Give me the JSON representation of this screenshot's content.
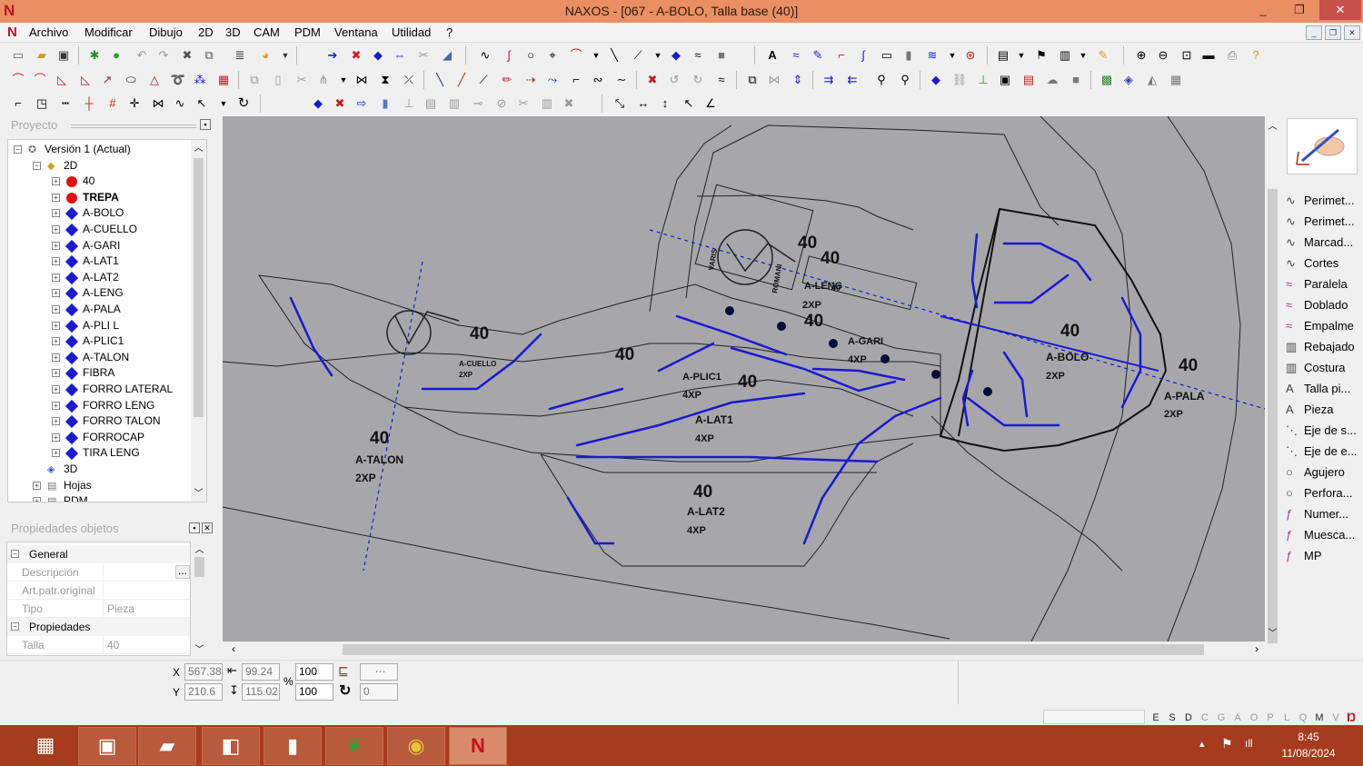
{
  "window": {
    "title": "NAXOS - [067 - A-BOLO, Talla base (40)]",
    "logo": "N",
    "controls": [
      "_",
      "❐",
      "✕"
    ],
    "mdi_controls": [
      "_",
      "❐",
      "✕"
    ]
  },
  "menu": [
    "Archivo",
    "Modificar",
    "Dibujo",
    "2D",
    "3D",
    "CAM",
    "PDM",
    "Ventana",
    "Utilidad",
    "?"
  ],
  "project_panel": {
    "header": "Proyecto",
    "tree": [
      {
        "label": "Versión 1 (Actual)",
        "level": 0,
        "icon": "version-icon",
        "expander": "−"
      },
      {
        "label": "2D",
        "level": 1,
        "icon": "2d-icon",
        "expander": "−"
      },
      {
        "label": "40",
        "level": 2,
        "icon": "red-dot",
        "expander": "+"
      },
      {
        "label": "TREPA",
        "level": 2,
        "icon": "red-dot",
        "expander": "+",
        "bold": true
      },
      {
        "label": "A-BOLO",
        "level": 2,
        "icon": "blue-diamond",
        "expander": "+"
      },
      {
        "label": "A-CUELLO",
        "level": 2,
        "icon": "blue-diamond",
        "expander": "+"
      },
      {
        "label": "A-GARI",
        "level": 2,
        "icon": "blue-diamond",
        "expander": "+"
      },
      {
        "label": "A-LAT1",
        "level": 2,
        "icon": "blue-diamond",
        "expander": "+"
      },
      {
        "label": "A-LAT2",
        "level": 2,
        "icon": "blue-diamond",
        "expander": "+"
      },
      {
        "label": "A-LENG",
        "level": 2,
        "icon": "blue-diamond",
        "expander": "+"
      },
      {
        "label": "A-PALA",
        "level": 2,
        "icon": "blue-diamond",
        "expander": "+"
      },
      {
        "label": "A-PLI L",
        "level": 2,
        "icon": "blue-diamond",
        "expander": "+"
      },
      {
        "label": "A-PLIC1",
        "level": 2,
        "icon": "blue-diamond",
        "expander": "+"
      },
      {
        "label": "A-TALON",
        "level": 2,
        "icon": "blue-diamond",
        "expander": "+"
      },
      {
        "label": "FIBRA",
        "level": 2,
        "icon": "blue-diamond",
        "expander": "+"
      },
      {
        "label": "FORRO LATERAL",
        "level": 2,
        "icon": "blue-diamond",
        "expander": "+"
      },
      {
        "label": "FORRO LENG",
        "level": 2,
        "icon": "blue-diamond",
        "expander": "+"
      },
      {
        "label": "FORRO TALON",
        "level": 2,
        "icon": "blue-diamond",
        "expander": "+"
      },
      {
        "label": "FORROCAP",
        "level": 2,
        "icon": "blue-diamond",
        "expander": "+"
      },
      {
        "label": "TIRA LENG",
        "level": 2,
        "icon": "blue-diamond",
        "expander": "+"
      },
      {
        "label": "3D",
        "level": 1,
        "icon": "3d-icon",
        "expander": ""
      },
      {
        "label": "Hojas",
        "level": 1,
        "icon": "sheets-icon",
        "expander": "+"
      },
      {
        "label": "PDM",
        "level": 1,
        "icon": "pdm-icon",
        "expander": "+"
      }
    ]
  },
  "properties_panel": {
    "header": "Propiedades objetos",
    "groups": [
      {
        "label": "General",
        "rows": [
          {
            "key": "Descripción",
            "value": "",
            "button": "..."
          },
          {
            "key": "Art.patr.original",
            "value": ""
          },
          {
            "key": "Tipo",
            "value": "Pieza"
          }
        ]
      },
      {
        "label": "Propiedades",
        "rows": [
          {
            "key": "Talla",
            "value": "40"
          }
        ]
      }
    ]
  },
  "canvas": {
    "labels": [
      {
        "text": "40",
        "kind": "size"
      },
      {
        "text": "A-CUELLO",
        "kind": "piece"
      },
      {
        "text": "2XP",
        "kind": "qty"
      },
      {
        "text": "40",
        "kind": "size"
      },
      {
        "text": "A-TALON",
        "kind": "piece"
      },
      {
        "text": "2XP",
        "kind": "qty"
      },
      {
        "text": "40",
        "kind": "size"
      },
      {
        "text": "40",
        "kind": "size"
      },
      {
        "text": "A-PLIC1",
        "kind": "piece"
      },
      {
        "text": "4XP",
        "kind": "qty"
      },
      {
        "text": "A-LAT1",
        "kind": "piece"
      },
      {
        "text": "4XP",
        "kind": "qty"
      },
      {
        "text": "40",
        "kind": "size"
      },
      {
        "text": "A-LAT2",
        "kind": "piece"
      },
      {
        "text": "4XP",
        "kind": "qty"
      },
      {
        "text": "40",
        "kind": "size"
      },
      {
        "text": "40",
        "kind": "size"
      },
      {
        "text": "A-LENG",
        "kind": "piece"
      },
      {
        "text": "2XP",
        "kind": "qty"
      },
      {
        "text": "40",
        "kind": "size"
      },
      {
        "text": "A-GARI",
        "kind": "piece"
      },
      {
        "text": "4XP",
        "kind": "qty"
      },
      {
        "text": "40",
        "kind": "size"
      },
      {
        "text": "A-BOLO",
        "kind": "piece"
      },
      {
        "text": "2XP",
        "kind": "qty"
      },
      {
        "text": "40",
        "kind": "size"
      },
      {
        "text": "A-PALA",
        "kind": "piece"
      },
      {
        "text": "2XP",
        "kind": "qty"
      },
      {
        "text": "VARIS",
        "kind": "logo"
      },
      {
        "text": "ROMANI",
        "kind": "logo"
      },
      {
        "text": "40",
        "kind": "size"
      }
    ]
  },
  "right_tools": [
    {
      "label": "Perimet...",
      "icon": "perimeter-icon"
    },
    {
      "label": "Perimet...",
      "icon": "perimeter-icon"
    },
    {
      "label": "Marcad...",
      "icon": "marker-icon"
    },
    {
      "label": "Cortes",
      "icon": "cut-icon"
    },
    {
      "label": "Paralela",
      "icon": "parallel-icon"
    },
    {
      "label": "Doblado",
      "icon": "fold-icon"
    },
    {
      "label": "Empalme",
      "icon": "join-icon"
    },
    {
      "label": "Rebajado",
      "icon": "skive-icon"
    },
    {
      "label": "Costura",
      "icon": "seam-icon"
    },
    {
      "label": "Talla pi...",
      "icon": "size-text-icon"
    },
    {
      "label": "Pieza",
      "icon": "piece-text-icon"
    },
    {
      "label": "Eje de s...",
      "icon": "axis-icon"
    },
    {
      "label": "Eje de e...",
      "icon": "axis-icon"
    },
    {
      "label": "Agujero",
      "icon": "hole-icon"
    },
    {
      "label": "Perfora...",
      "icon": "perforate-icon"
    },
    {
      "label": "Numer...",
      "icon": "number-icon"
    },
    {
      "label": "Muesca...",
      "icon": "notch-icon"
    },
    {
      "label": "MP",
      "icon": "mp-icon"
    }
  ],
  "coords": {
    "x_label": "X",
    "x_value": "567.38",
    "y_label": "Y",
    "y_value": "210.6",
    "w_value": "99.24",
    "h_value": "115.02",
    "scale_x": "100",
    "scale_y": "100",
    "percent": "%",
    "rotation": "0"
  },
  "status_letters": [
    "E",
    "S",
    "D",
    "C",
    "G",
    "A",
    "O",
    "P",
    "L",
    "Q",
    "M",
    "V"
  ],
  "taskbar": {
    "time": "8:45",
    "date": "11/08/2024",
    "tray": [
      "▴",
      "⚑",
      "ıll"
    ]
  }
}
